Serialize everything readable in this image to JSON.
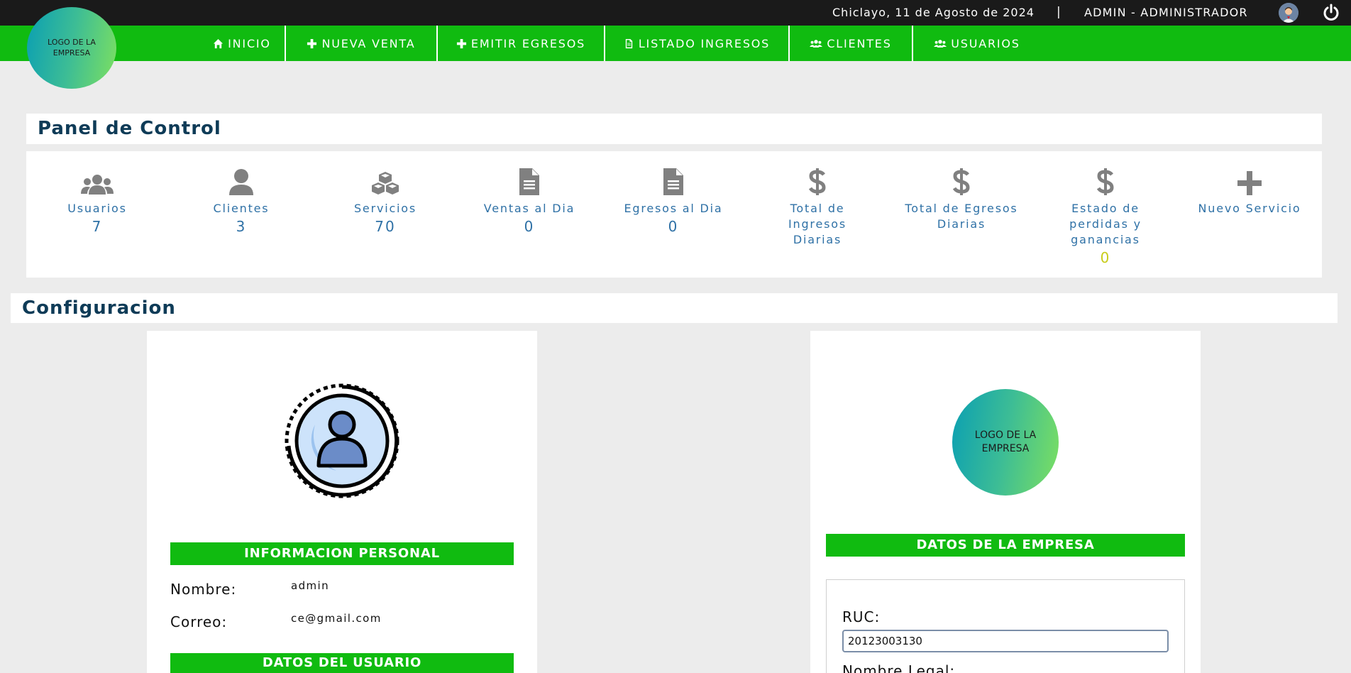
{
  "topbar": {
    "date": "Chiclayo, 11 de Agosto de 2024",
    "separator": "|",
    "user": "ADMIN - ADMINISTRADOR"
  },
  "logo_text": "LOGO DE LA EMPRESA",
  "nav": [
    {
      "label": "INICIO",
      "icon": "home-icon"
    },
    {
      "label": "NUEVA VENTA",
      "icon": "plus-icon"
    },
    {
      "label": "EMITIR EGRESOS",
      "icon": "plus-icon"
    },
    {
      "label": "LISTADO INGRESOS",
      "icon": "file-icon"
    },
    {
      "label": "CLIENTES",
      "icon": "users-icon"
    },
    {
      "label": "USUARIOS",
      "icon": "users-icon"
    }
  ],
  "panel": {
    "title": "Panel de Control",
    "stats": [
      {
        "label": "Usuarios",
        "value": "7",
        "icon": "users-icon"
      },
      {
        "label": "Clientes",
        "value": "3",
        "icon": "user-icon"
      },
      {
        "label": "Servicios",
        "value": "70",
        "icon": "cubes-icon"
      },
      {
        "label": "Ventas al Dia",
        "value": "0",
        "icon": "file-text-icon"
      },
      {
        "label": "Egresos al Dia",
        "value": "0",
        "icon": "file-text-icon"
      },
      {
        "label": "Total de Ingresos Diarias",
        "value": "",
        "icon": "dollar-icon"
      },
      {
        "label": "Total de Egresos Diarias",
        "value": "",
        "icon": "dollar-icon"
      },
      {
        "label": "Estado de perdidas y ganancias",
        "value": "0",
        "icon": "dollar-icon"
      },
      {
        "label": "Nuevo Servicio",
        "value": "",
        "icon": "plus-icon"
      }
    ],
    "profit_color": "#c8cc1a"
  },
  "config": {
    "title": "Configuracion",
    "personal": {
      "header": "INFORMACION PERSONAL",
      "name_label": "Nombre:",
      "name_value": "admin",
      "email_label": "Correo:",
      "email_value": "ce@gmail.com",
      "user_header": "DATOS DEL USUARIO"
    },
    "company": {
      "header": "DATOS DE LA EMPRESA",
      "ruc_label": "RUC:",
      "ruc_value": "20123003130",
      "legal_name_label": "Nombre Legal:"
    }
  },
  "colors": {
    "nav_green": "#10bb10",
    "title_blue": "#0e3b57",
    "stat_blue": "#2f71a6"
  }
}
